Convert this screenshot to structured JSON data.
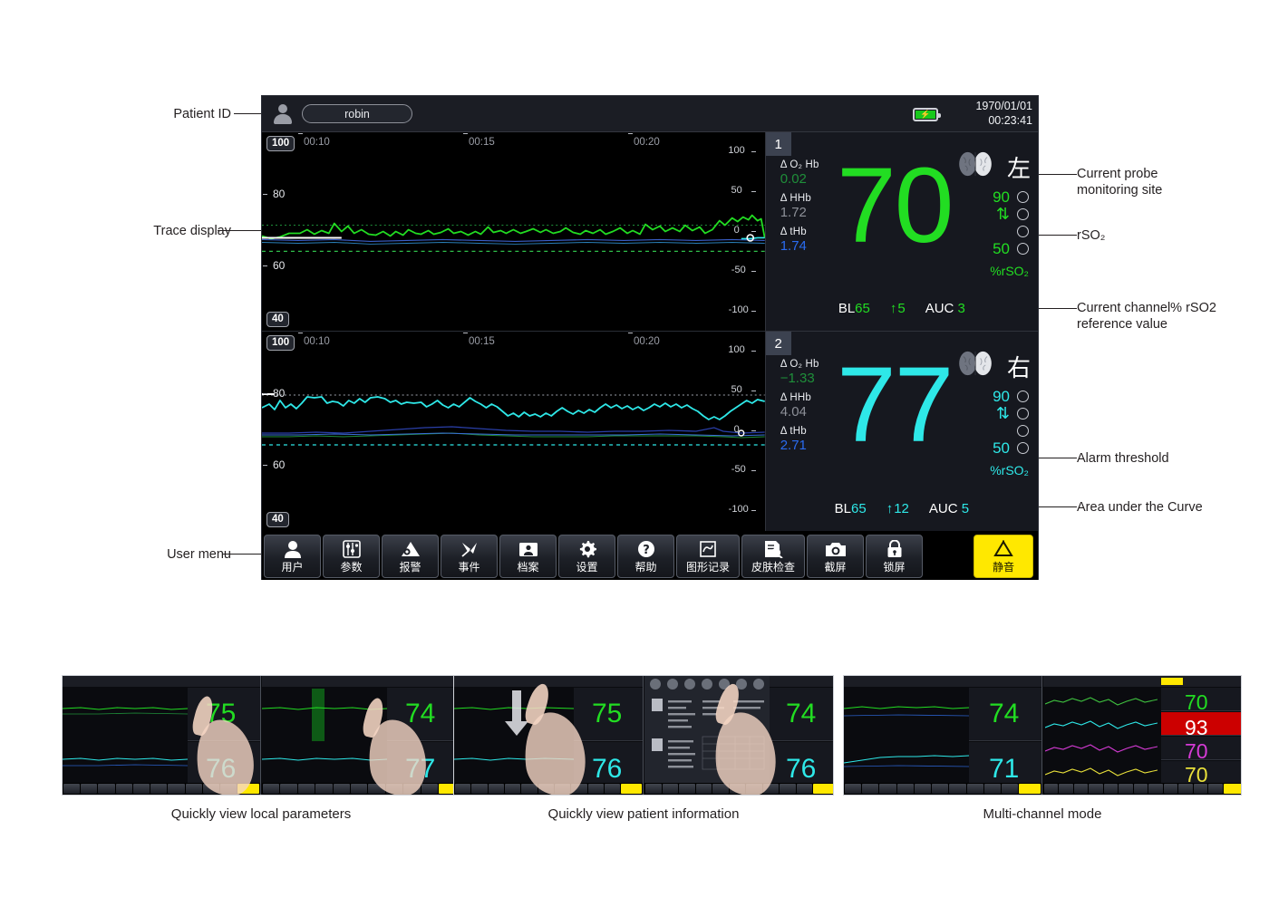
{
  "annotations": {
    "left": [
      {
        "id": "patient-id",
        "text": "Patient ID"
      },
      {
        "id": "trace-display",
        "text": "Trace display"
      },
      {
        "id": "user-menu",
        "text": "User menu"
      }
    ],
    "right": [
      {
        "id": "probe-site",
        "text": "Current probe\nmonitoring site"
      },
      {
        "id": "rso2",
        "text": "rSO₂"
      },
      {
        "id": "reference-value",
        "text": "Current channel% rSO2\nreference value"
      },
      {
        "id": "alarm-threshold",
        "text": "Alarm threshold"
      },
      {
        "id": "auc",
        "text": "Area under the Curve"
      }
    ]
  },
  "statusbar": {
    "patient_name": "robin",
    "patient_icon": "person-icon",
    "battery_icon": "battery-charging-icon",
    "battery_glyph": "⚡",
    "date": "1970/01/01",
    "time": "00:23:41"
  },
  "traces": {
    "time_labels": [
      "00:10",
      "00:15",
      "00:20"
    ],
    "rows": [
      {
        "channel": "1",
        "scale_top": "100",
        "scale_bottom": "40",
        "y_left": [
          "80",
          "60"
        ],
        "y_right": [
          "100",
          "50",
          "0",
          "-50",
          "-100"
        ],
        "trace_color": "#22dd22",
        "ref_color": "#1f8f3a"
      },
      {
        "channel": "2",
        "scale_top": "100",
        "scale_bottom": "40",
        "y_left": [
          "80",
          "60"
        ],
        "y_right": [
          "100",
          "50",
          "0",
          "-50",
          "-100"
        ],
        "trace_color": "#2ee8e8",
        "ref_color": "#1f8fa0"
      }
    ]
  },
  "channels": [
    {
      "number": "1",
      "accent": "#22dd22",
      "side_label": "左",
      "brain_icon": "brain-icon",
      "value": "70",
      "params": [
        {
          "label": "Δ O₂ Hb",
          "value": "0.02",
          "cls": "v-o2"
        },
        {
          "label": "Δ HHb",
          "value": "1.72",
          "cls": "v-hhb"
        },
        {
          "label": "Δ tHb",
          "value": "1.74",
          "cls": "v-thb"
        }
      ],
      "threshold_high": "90",
      "threshold_low": "50",
      "unit": "%rSO₂",
      "bl_label": "BL",
      "bl_value": "65",
      "trend_arrow": "↑",
      "trend_value": "5",
      "auc_label": "AUC",
      "auc_value": "3"
    },
    {
      "number": "2",
      "accent": "#2ee8e8",
      "side_label": "右",
      "brain_icon": "brain-icon",
      "value": "77",
      "params": [
        {
          "label": "Δ O₂ Hb",
          "value": "−1.33",
          "cls": "v-o2"
        },
        {
          "label": "Δ HHb",
          "value": "4.04",
          "cls": "v-hhb"
        },
        {
          "label": "Δ tHb",
          "value": "2.71",
          "cls": "v-thb"
        }
      ],
      "threshold_high": "90",
      "threshold_low": "50",
      "unit": "%rSO₂",
      "bl_label": "BL",
      "bl_value": "65",
      "trend_arrow": "↑",
      "trend_value": "12",
      "auc_label": "AUC",
      "auc_value": "5"
    }
  ],
  "menu": [
    {
      "label": "用户",
      "icon": "user-icon"
    },
    {
      "label": "参数",
      "icon": "parameters-icon"
    },
    {
      "label": "报警",
      "icon": "alarm-icon"
    },
    {
      "label": "事件",
      "icon": "pin-icon"
    },
    {
      "label": "档案",
      "icon": "records-icon"
    },
    {
      "label": "设置",
      "icon": "gear-icon"
    },
    {
      "label": "帮助",
      "icon": "help-icon"
    },
    {
      "label": "图形记录",
      "icon": "graph-record-icon"
    },
    {
      "label": "皮肤检查",
      "icon": "skin-check-icon"
    },
    {
      "label": "截屏",
      "icon": "camera-icon"
    },
    {
      "label": "锁屏",
      "icon": "lock-icon"
    }
  ],
  "menu_mute": {
    "label": "静音",
    "icon": "bell-icon",
    "color": "#ffe800"
  },
  "thumbnails": [
    {
      "caption": "Quickly view local parameters",
      "left_values": [
        "75",
        "76"
      ],
      "right_values": [
        "74",
        "77"
      ],
      "colors": [
        "#22dd22",
        "#2ee8e8"
      ]
    },
    {
      "caption": "Quickly view patient information",
      "left_values": [
        "75",
        "76"
      ],
      "right_values": [
        "74",
        "76"
      ],
      "colors": [
        "#22dd22",
        "#2ee8e8"
      ]
    },
    {
      "caption": "Multi-channel mode",
      "left_values": [
        "74",
        "71"
      ],
      "right_values": [
        "70",
        "93",
        "70",
        "70"
      ],
      "colors": [
        "#22dd22",
        "#2ee8e8",
        "#d63bd6",
        "#e8e03a"
      ],
      "alarm_index": 1,
      "alarm_color": "#cc0000"
    }
  ]
}
